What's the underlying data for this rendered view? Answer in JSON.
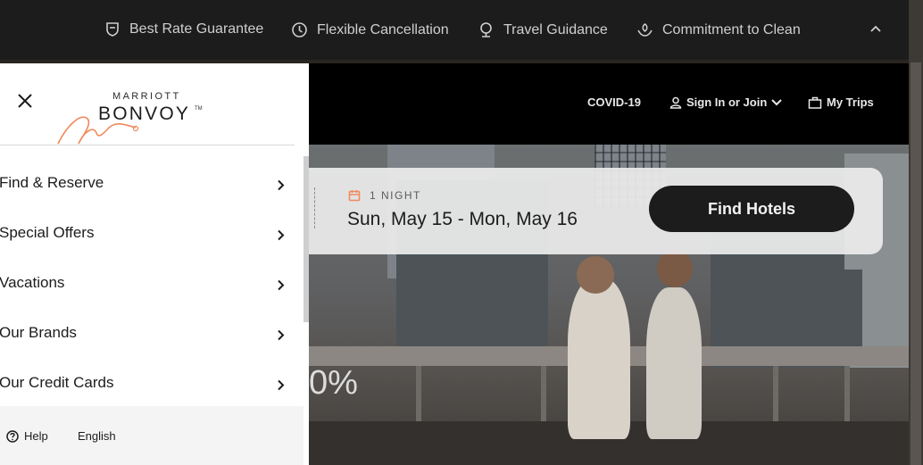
{
  "benefits": {
    "items": [
      {
        "label": "Best Rate Guarantee",
        "icon": "shield-check-icon"
      },
      {
        "label": "Flexible Cancellation",
        "icon": "clock-icon"
      },
      {
        "label": "Travel Guidance",
        "icon": "globe-pin-icon"
      },
      {
        "label": "Commitment to Clean",
        "icon": "hands-leaf-icon"
      }
    ],
    "collapse_icon": "chevron-up-icon"
  },
  "header": {
    "covid": "COVID-19",
    "signin": "Sign In or Join",
    "mytrips": "My Trips"
  },
  "search": {
    "nights": "1 NIGHT",
    "dates": "Sun, May 15 - Mon, May 16",
    "find_button": "Find Hotels"
  },
  "hero": {
    "partial_text": "0%"
  },
  "drawer": {
    "logo_top": "MARRIOTT",
    "logo_main": "BONVOY",
    "logo_tm": "TM",
    "menu": [
      {
        "label": "Find & Reserve"
      },
      {
        "label": "Special Offers"
      },
      {
        "label": "Vacations"
      },
      {
        "label": "Our Brands"
      },
      {
        "label": "Our Credit Cards"
      }
    ],
    "footer": {
      "help": "Help",
      "language": "English"
    }
  },
  "colors": {
    "accent": "#f08a5d",
    "dark": "#1c1c1c"
  }
}
